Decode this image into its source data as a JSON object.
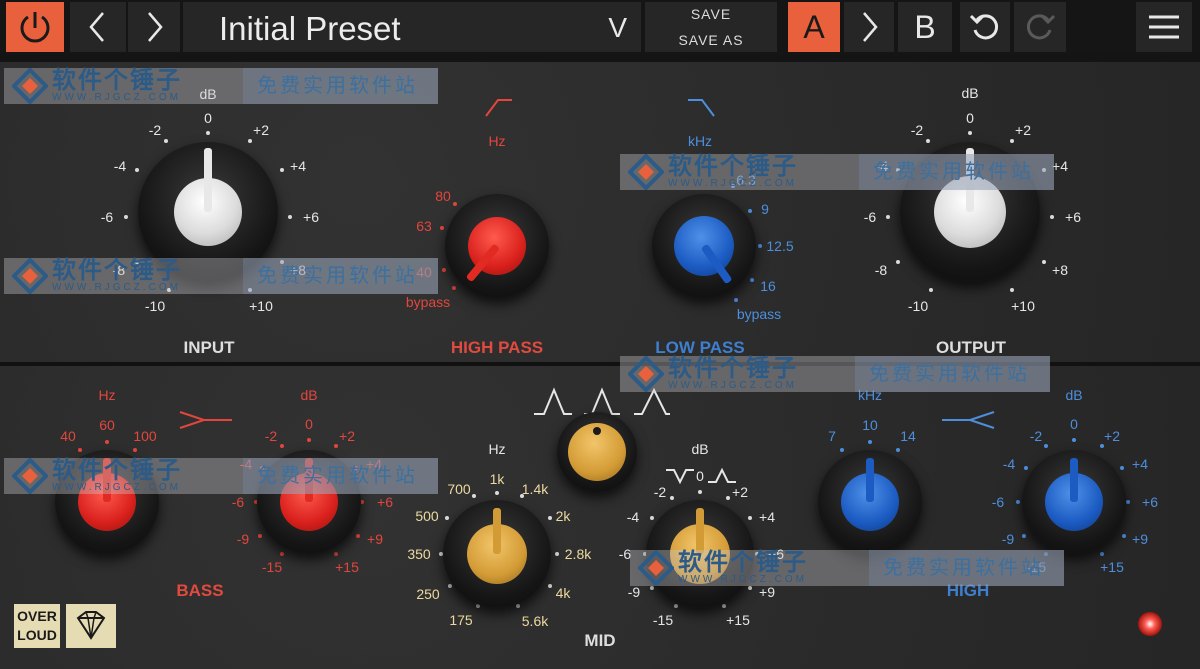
{
  "toolbar": {
    "preset_name": "Initial Preset",
    "dropdown_glyph": "V",
    "save_label": "SAVE",
    "save_as_label": "SAVE AS",
    "ab_a_label": "A",
    "ab_b_label": "B",
    "icons": {
      "power": "power-icon",
      "prev": "chevron-left-icon",
      "next": "chevron-right-icon",
      "undo": "undo-icon",
      "redo": "redo-icon",
      "menu": "menu-icon"
    }
  },
  "sections": {
    "input_label": "INPUT",
    "high_pass_label": "HIGH PASS",
    "low_pass_label": "LOW PASS",
    "output_label": "OUTPUT",
    "bass_label": "BASS",
    "mid_label": "MID",
    "high_label": "HIGH"
  },
  "units": {
    "db": "dB",
    "hz": "Hz",
    "khz": "kHz"
  },
  "scales": {
    "gain10": [
      "-10",
      "-8",
      "-6",
      "-4",
      "-2",
      "0",
      "+2",
      "+4",
      "+6",
      "+8",
      "+10"
    ],
    "gain15": [
      "-15",
      "-9",
      "-6",
      "-4",
      "-2",
      "0",
      "+2",
      "+4",
      "+6",
      "+9",
      "+15"
    ],
    "high_pass": [
      "bypass",
      "40",
      "63",
      "80"
    ],
    "low_pass": [
      "6.3",
      "9",
      "12.5",
      "16",
      "bypass"
    ],
    "bass_freq": [
      "40",
      "60",
      "100"
    ],
    "mid_freq": [
      "175",
      "250",
      "350",
      "500",
      "700",
      "1k",
      "1.4k",
      "2k",
      "2.8k",
      "4k",
      "5.6k"
    ],
    "high_freq": [
      "7",
      "10",
      "14"
    ]
  },
  "brand": {
    "line1": "OVER",
    "line2": "LOUD"
  },
  "watermark": {
    "cn_name": "软件个锤子",
    "url": "WWW.RJGCZ.COM",
    "slogan": "免费实用软件站"
  },
  "colors": {
    "accent_orange": "#e8603c",
    "red_label": "#e04a3f",
    "blue_label": "#3f7fd0",
    "panel": "#2d2d2d"
  }
}
